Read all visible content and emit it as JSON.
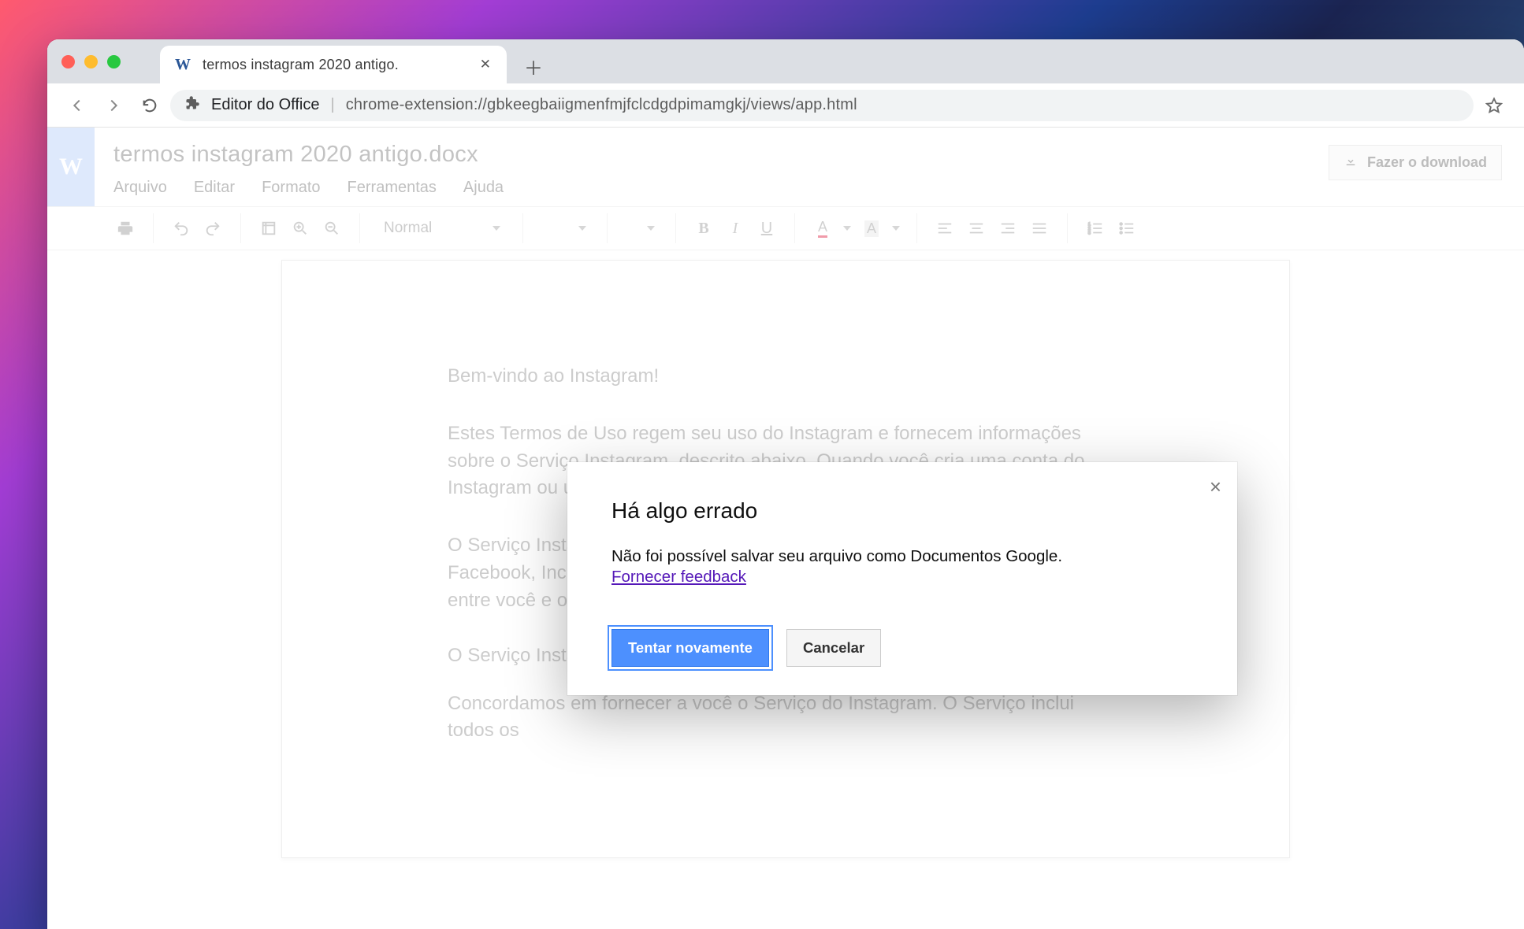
{
  "tab": {
    "title": "termos instagram 2020 antigo.",
    "favicon_letter": "W"
  },
  "address": {
    "label": "Editor do Office",
    "url": "chrome-extension://gbkeegbaiigmenfmjfclcdgdpimamgkj/views/app.html"
  },
  "doc": {
    "logo_letter": "W",
    "title": "termos instagram 2020 antigo.docx",
    "menu": [
      "Arquivo",
      "Editar",
      "Formato",
      "Ferramentas",
      "Ajuda"
    ],
    "download_label": "Fazer o download",
    "style_dropdown": "Normal",
    "body": {
      "p1": "Bem-vindo ao Instagram!",
      "p2": "Estes Termos de Uso regem seu uso do Instagram e fornecem informações sobre o Serviço Instagram, descrito abaixo. Quando você cria uma conta do Instagram ou usa o Instagram, concorda com estes termos.",
      "p3": "O Serviço Instagram é um dos Produtos do Facebook, fornecido a você pelo Facebook, Inc. Estes Termos de Uso, por conseguinte, constituem um acordo entre você e o Facebook, Inc.",
      "h3": "O Serviço Instagram",
      "p4": "Concordamos em fornecer a você o Serviço do Instagram. O Serviço inclui todos os"
    }
  },
  "modal": {
    "title": "Há algo errado",
    "message": "Não foi possível salvar seu arquivo como Documentos Google.",
    "feedback_link": "Fornecer feedback",
    "primary": "Tentar novamente",
    "secondary": "Cancelar"
  }
}
